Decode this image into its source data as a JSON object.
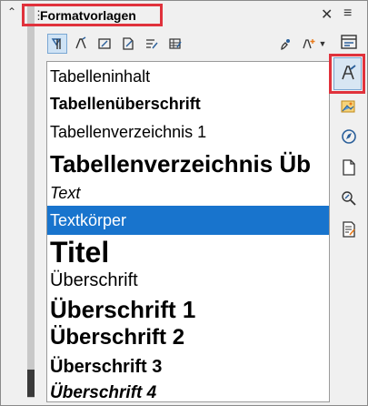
{
  "panel": {
    "title": "Formatvorlagen",
    "grip": "⋮",
    "close": "✕",
    "menu": "≡"
  },
  "styles": [
    {
      "label": "Tabelleninhalt"
    },
    {
      "label": "Tabellenüberschrift"
    },
    {
      "label": "Tabellenverzeichnis 1"
    },
    {
      "label": "Tabellenverzeichnis Üb"
    },
    {
      "label": "Text"
    },
    {
      "label": "Textkörper",
      "selected": true
    },
    {
      "label": "Titel"
    },
    {
      "label": "Überschrift"
    },
    {
      "label": "Überschrift 1"
    },
    {
      "label": "Überschrift 2"
    },
    {
      "label": "Überschrift 3"
    },
    {
      "label": "Überschrift 4"
    }
  ],
  "toolbar": {
    "buttons": [
      "paragraph-styles-icon",
      "character-styles-icon",
      "frame-styles-icon",
      "page-styles-icon",
      "list-styles-icon",
      "table-styles-icon"
    ],
    "fill_format": "fill-format-icon",
    "new_style": "new-style-icon"
  },
  "sidebar": {
    "buttons": [
      "properties-icon",
      "styles-icon",
      "gallery-icon",
      "navigator-icon",
      "page-icon",
      "style-inspector-icon",
      "manage-changes-icon"
    ]
  },
  "colors": {
    "selection": "#1874cd",
    "highlight_box": "#e0323c"
  }
}
